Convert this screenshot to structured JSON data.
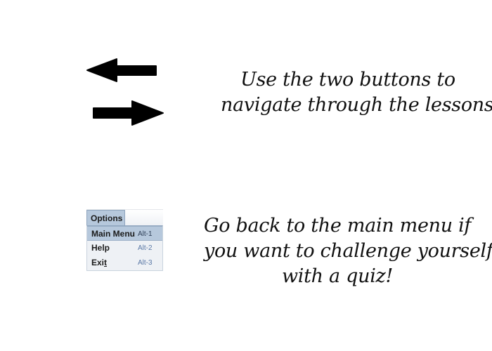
{
  "navigation": {
    "back_arrow": "arrow-left-icon",
    "forward_arrow": "arrow-right-icon",
    "instruction_lines": [
      "Use the two buttons to",
      "navigate through the lessons!"
    ]
  },
  "menu": {
    "title": "Options",
    "items": [
      {
        "label": "Main Menu",
        "shortcut": "Alt-1",
        "selected": true
      },
      {
        "label": "Help",
        "shortcut": "Alt-2",
        "selected": false
      },
      {
        "label_prefix": "Exi",
        "label_mnemonic": "t",
        "shortcut": "Alt-3",
        "selected": false
      }
    ],
    "instruction_lines": [
      "Go back to the main menu if",
      "you want to challenge yourself",
      "with a quiz!"
    ]
  },
  "colors": {
    "background": "#ffffff",
    "arrow": "#000000",
    "menu_highlight": "#b6c8dc",
    "menu_background": "#eef1f5",
    "shortcut_text": "#5a78a6"
  }
}
